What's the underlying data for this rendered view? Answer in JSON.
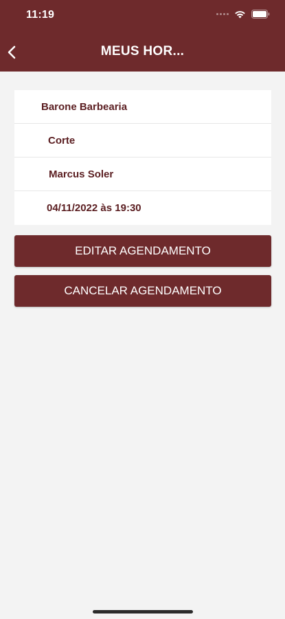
{
  "status_bar": {
    "time": "11:19",
    "icons": [
      "signal-icon",
      "wifi-icon",
      "battery-icon"
    ]
  },
  "header": {
    "title": "MEUS HOR...",
    "back_icon": "chevron-left-icon"
  },
  "appointment": {
    "shop": "Barone Barbearia",
    "service": "Corte",
    "professional": "Marcus Soler",
    "datetime": "04/11/2022 às 19:30"
  },
  "actions": {
    "edit_label": "EDITAR AGENDAMENTO",
    "cancel_label": "CANCELAR AGENDAMENTO"
  },
  "colors": {
    "primary": "#6e2a2c",
    "text_accent": "#5a1d20",
    "background": "#f3f3f3"
  }
}
